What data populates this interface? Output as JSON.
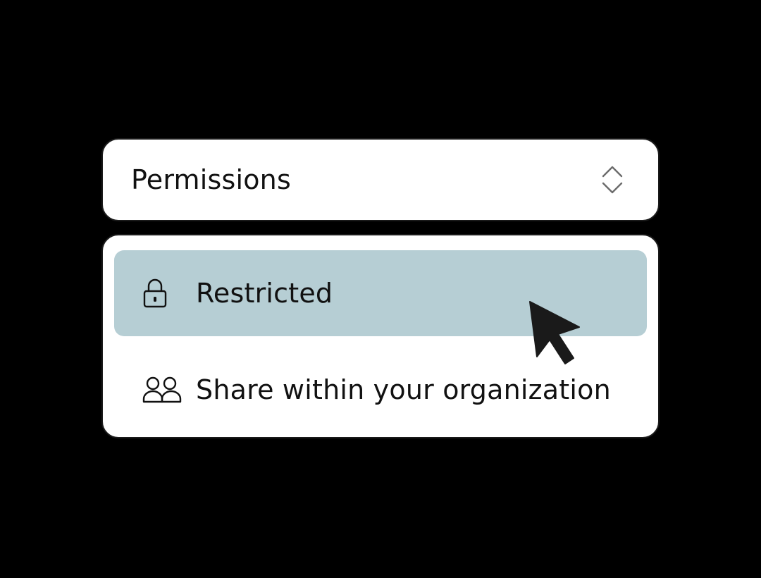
{
  "permissions_select": {
    "label": "Permissions",
    "toggle_icon": "chevron-up-down-icon"
  },
  "options": [
    {
      "label": "Restricted",
      "icon": "lock-icon",
      "selected": true
    },
    {
      "label": "Share within your organization",
      "icon": "users-icon",
      "selected": false
    }
  ],
  "colors": {
    "background": "#000000",
    "panel": "#ffffff",
    "highlight": "#b6ced4",
    "text": "#111111"
  },
  "cursor": {
    "icon": "mouse-pointer-icon"
  }
}
